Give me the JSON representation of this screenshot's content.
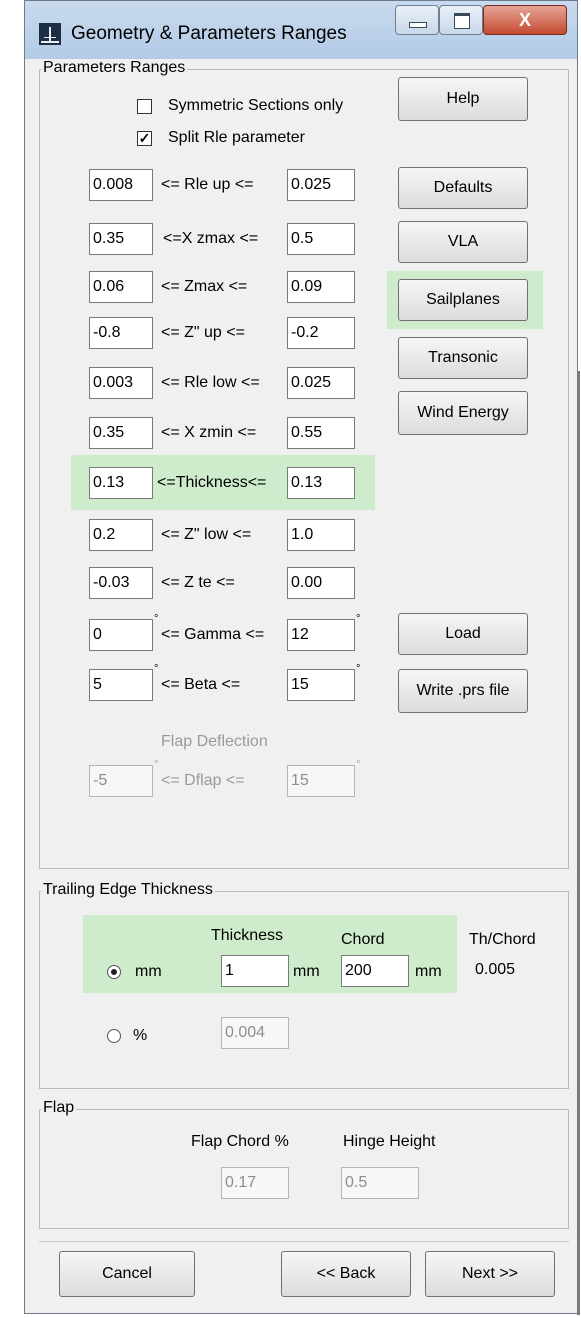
{
  "window": {
    "title": "Geometry & Parameters Ranges",
    "close_glyph": "X"
  },
  "colors": {
    "highlight": "#c8ebc4",
    "titlebar": "#b9cfe8"
  },
  "params_group": {
    "label": "Parameters Ranges",
    "symmetric_label": "Symmetric Sections only",
    "symmetric_checked": false,
    "split_label": "Split Rle parameter",
    "split_checked": true,
    "checkmark": "✓",
    "rows": [
      {
        "min": "0.008",
        "label": "<=  Rle up  <=",
        "max": "0.025"
      },
      {
        "min": "0.35",
        "label": "<=X zmax  <=",
        "max": "0.5"
      },
      {
        "min": "0.06",
        "label": "<=   Zmax   <=",
        "max": "0.09"
      },
      {
        "min": "-0.8",
        "label": "<=   Z\" up   <=",
        "max": "-0.2"
      },
      {
        "min": "0.003",
        "label": "<=  Rle low <=",
        "max": "0.025"
      },
      {
        "min": "0.35",
        "label": "<=  X zmin  <=",
        "max": "0.55"
      },
      {
        "min": "0.13",
        "label": "<=Thickness<=",
        "max": "0.13"
      },
      {
        "min": "0.2",
        "label": "<=   Z\" low <=",
        "max": "1.0"
      },
      {
        "min": "-0.03",
        "label": "<=     Z te   <=",
        "max": "0.00"
      },
      {
        "min": "0",
        "label": "<= Gamma <=",
        "max": "12"
      },
      {
        "min": "5",
        "label": "<=    Beta   <=",
        "max": "15"
      }
    ],
    "degree_mark": "°",
    "flap_deflection_label": "Flap Deflection",
    "dflap": {
      "min": "-5",
      "label": "<=    Dflap   <=",
      "max": "15"
    },
    "buttons": {
      "help": "Help",
      "defaults": "Defaults",
      "vla": "VLA",
      "sailplanes": "Sailplanes",
      "transonic": "Transonic",
      "wind_energy": "Wind Energy",
      "load": "Load",
      "write_prs": "Write .prs file"
    }
  },
  "te_group": {
    "label": "Trailing Edge Thickness",
    "thickness_header": "Thickness",
    "chord_header": "Chord",
    "ratio_header": "Th/Chord",
    "mm_option": "mm",
    "mm_selected": true,
    "pct_option": "%",
    "thickness_value": "1",
    "thickness_unit": "mm",
    "chord_value": "200",
    "chord_unit": "mm",
    "ratio_value": "0.005",
    "pct_value": "0.004"
  },
  "flap_group": {
    "label": "Flap",
    "chord_label": "Flap Chord %",
    "hinge_label": "Hinge Height",
    "chord_value": "0.17",
    "hinge_value": "0.5"
  },
  "footer": {
    "cancel": "Cancel",
    "back": "<< Back",
    "next": "Next >>"
  }
}
